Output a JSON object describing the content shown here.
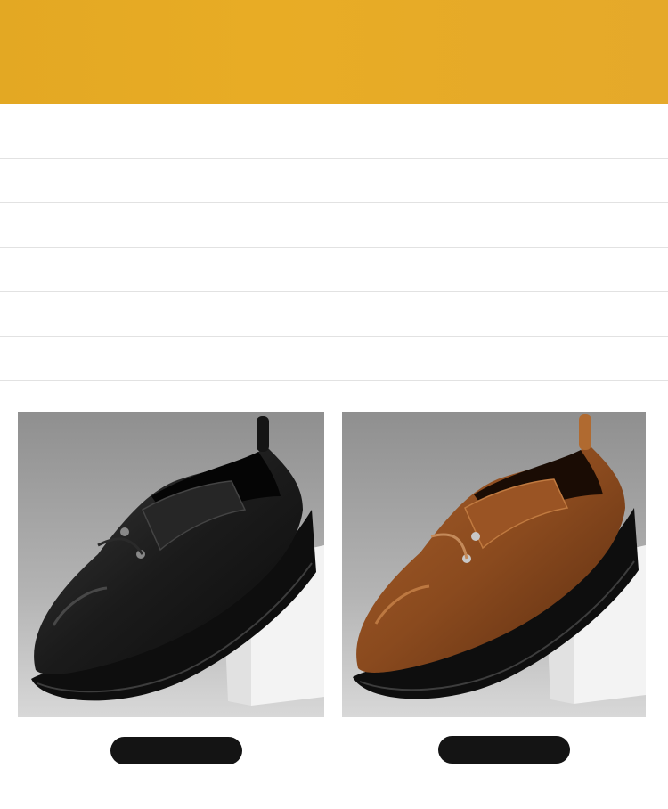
{
  "banner": {
    "title": "",
    "color": "#E6AA26"
  },
  "specs": [
    {
      "text": ""
    },
    {
      "text": ""
    },
    {
      "text": ""
    },
    {
      "text": ""
    },
    {
      "text": ""
    },
    {
      "text": ""
    }
  ],
  "products": [
    {
      "icon": "black-leather-shoe",
      "leather_color": "#1b1b1b",
      "label": ""
    },
    {
      "icon": "brown-leather-shoe",
      "leather_color": "#8a4a1e",
      "label": ""
    }
  ]
}
